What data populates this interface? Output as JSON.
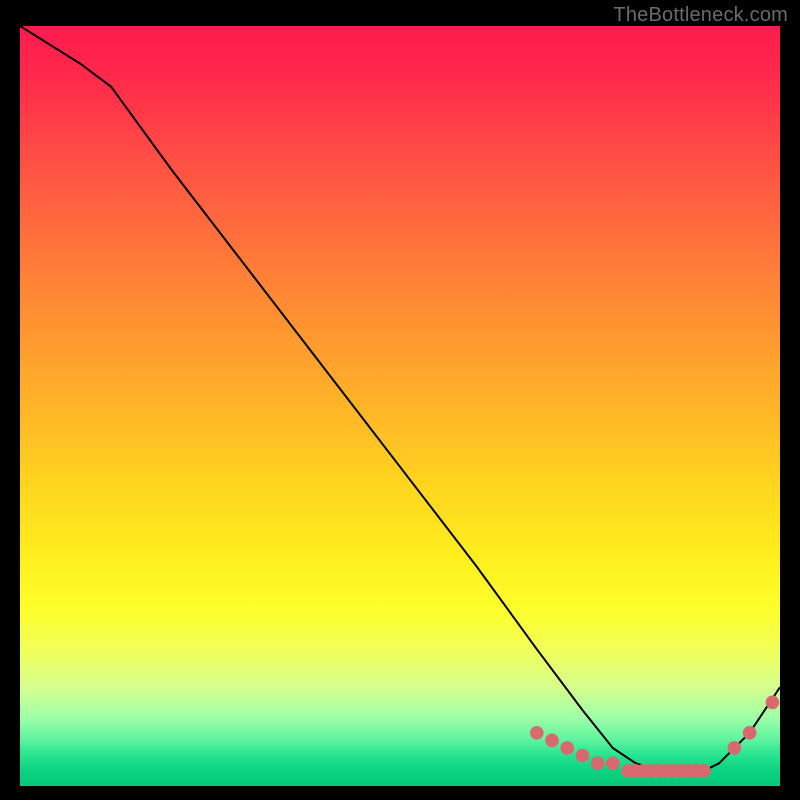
{
  "watermark": "TheBottleneck.com",
  "chart_data": {
    "type": "line",
    "title": "",
    "xlabel": "",
    "ylabel": "",
    "xlim": [
      0,
      100
    ],
    "ylim": [
      0,
      100
    ],
    "curve": {
      "x": [
        0,
        8,
        12,
        20,
        30,
        40,
        50,
        60,
        68,
        74,
        78,
        81,
        84,
        87,
        90,
        92,
        94,
        96,
        98,
        100
      ],
      "y": [
        100,
        95,
        92,
        81,
        68,
        55,
        42,
        29,
        18,
        10,
        5,
        3,
        2,
        2,
        2,
        3,
        5,
        7,
        10,
        13
      ]
    },
    "dots_valley": {
      "x": [
        68,
        70,
        72,
        74,
        76,
        78,
        80,
        81,
        82,
        83,
        84,
        85,
        86,
        87,
        88,
        89,
        90
      ],
      "y": [
        7,
        6,
        5,
        4,
        3,
        3,
        2,
        2,
        2,
        2,
        2,
        2,
        2,
        2,
        2,
        2,
        2
      ]
    },
    "dots_rise": {
      "x": [
        94,
        96,
        99
      ],
      "y": [
        5,
        7,
        11
      ]
    },
    "colors": {
      "curve": "#000000",
      "dots": "#d86a6f"
    }
  }
}
